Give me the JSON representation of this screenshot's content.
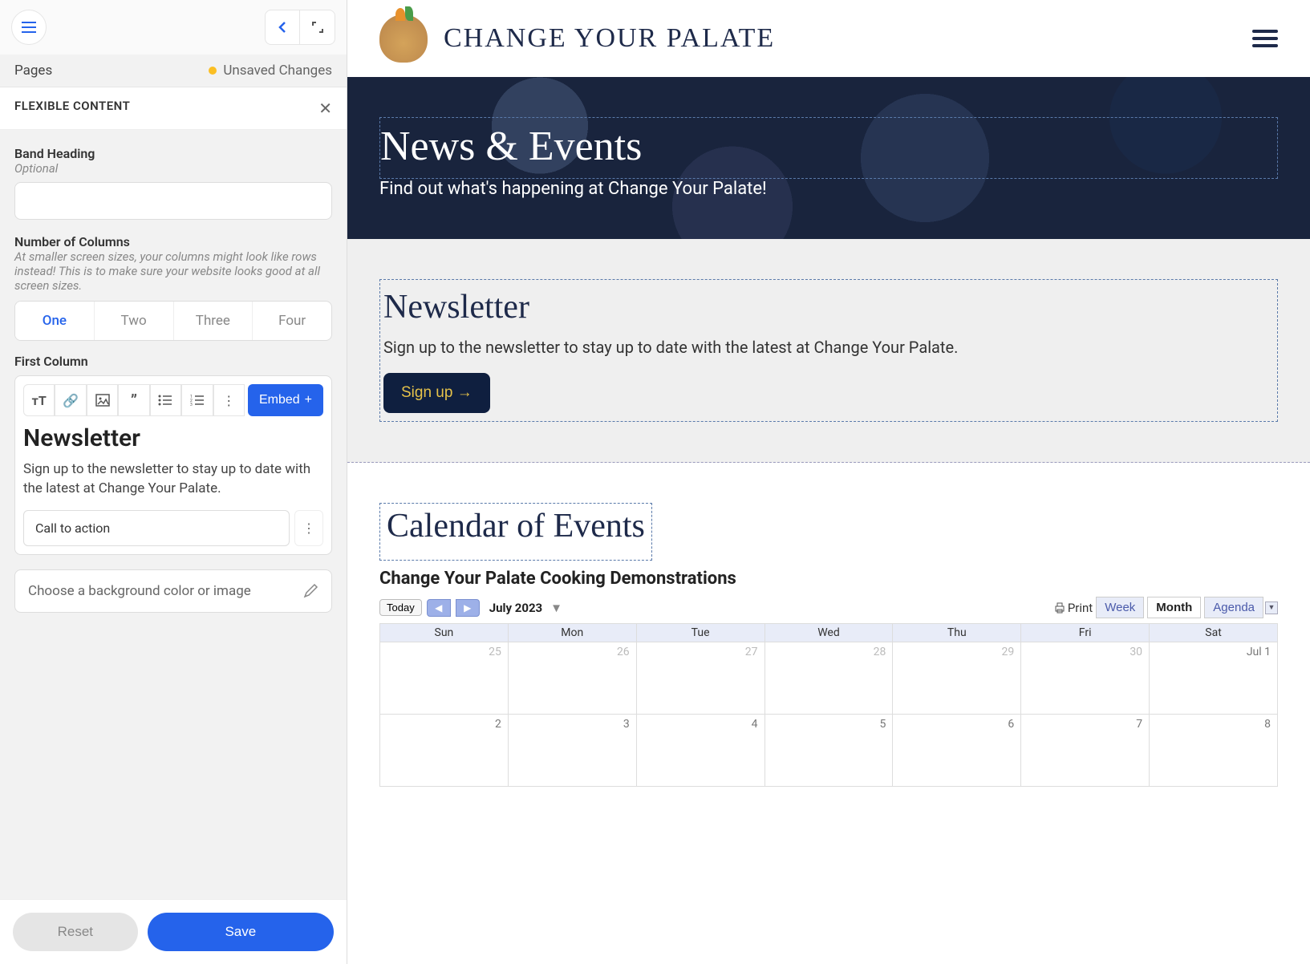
{
  "sidebar": {
    "pages_label": "Pages",
    "unsaved": "Unsaved Changes",
    "panel_title": "FLEXIBLE CONTENT",
    "band_heading_label": "Band Heading",
    "band_heading_hint": "Optional",
    "band_heading_value": "",
    "columns_label": "Number of Columns",
    "columns_hint": "At smaller screen sizes, your columns might look like rows instead! This is to make sure your website looks good at all screen sizes.",
    "columns_options": [
      "One",
      "Two",
      "Three",
      "Four"
    ],
    "first_column_label": "First Column",
    "embed_label": "Embed",
    "editor_heading": "Newsletter",
    "editor_body": "Sign up to the newsletter to stay up to date with the latest at Change Your Palate.",
    "cta_label": "Call to action",
    "bg_placeholder": "Choose a background color or image",
    "reset": "Reset",
    "save": "Save"
  },
  "site": {
    "brand": "CHANGE YOUR PALATE",
    "hero_title": "News & Events",
    "hero_sub": "Find out what's happening at Change Your Palate!",
    "newsletter_h": "Newsletter",
    "newsletter_p": "Sign up to the newsletter to stay up to date with the latest at Change Your Palate.",
    "signup": "Sign up →",
    "calendar_h": "Calendar of Events",
    "cal_title": "Change Your Palate Cooking Demonstrations",
    "today": "Today",
    "month_label": "July 2023",
    "print": "Print",
    "views": [
      "Week",
      "Month",
      "Agenda"
    ],
    "days": [
      "Sun",
      "Mon",
      "Tue",
      "Wed",
      "Thu",
      "Fri",
      "Sat"
    ],
    "row1": [
      "25",
      "26",
      "27",
      "28",
      "29",
      "30",
      "Jul 1"
    ],
    "row2": [
      "2",
      "3",
      "4",
      "5",
      "6",
      "7",
      "8"
    ]
  }
}
